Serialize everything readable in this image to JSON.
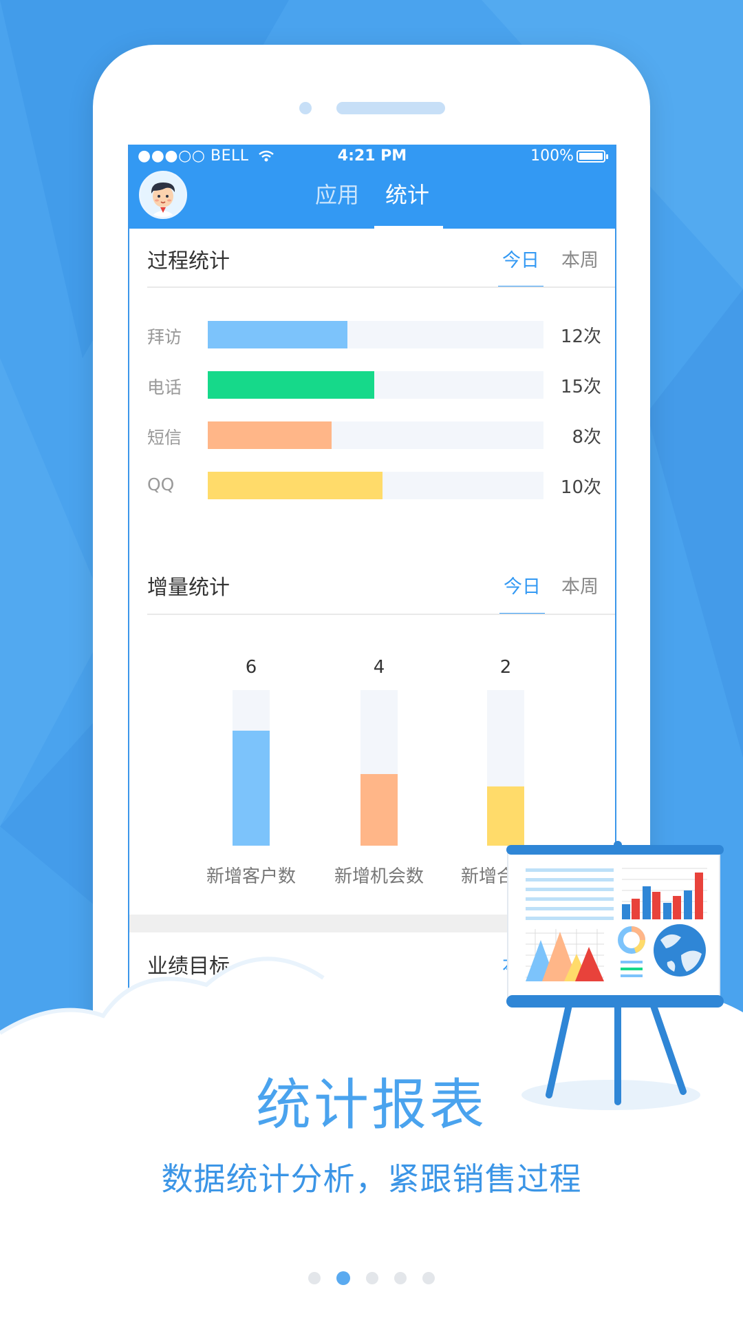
{
  "status_bar": {
    "carrier": "●●●○○ BELL",
    "time": "4:21 PM",
    "battery": "100%"
  },
  "header": {
    "tabs": [
      {
        "label": "应用"
      },
      {
        "label": "统计"
      }
    ],
    "active_tab": "统计"
  },
  "process_stats": {
    "title": "过程统计",
    "segments": {
      "today": "今日",
      "week": "本周"
    },
    "rows": [
      {
        "label": "拜访",
        "value": "12次",
        "fraction": 0.415,
        "color": "#7cc3fb"
      },
      {
        "label": "电话",
        "value": "15次",
        "fraction": 0.495,
        "color": "#16d98a"
      },
      {
        "label": "短信",
        "value": "8次",
        "fraction": 0.368,
        "color": "#ffb688"
      },
      {
        "label": "QQ",
        "value": "10次",
        "fraction": 0.52,
        "color": "#ffdb6a"
      }
    ]
  },
  "increment_stats": {
    "title": "增量统计",
    "segments": {
      "today": "今日",
      "week": "本周"
    },
    "columns": [
      {
        "label": "新增客户数",
        "value": "6",
        "fraction": 0.74,
        "color": "#7cc3fb"
      },
      {
        "label": "新增机会数",
        "value": "4",
        "fraction": 0.46,
        "color": "#ffb688"
      },
      {
        "label": "新增合同数",
        "value": "2",
        "fraction": 0.38,
        "color": "#ffdb6a"
      }
    ]
  },
  "performance": {
    "title": "业绩目标",
    "segment_partial": "本"
  },
  "promo": {
    "title": "统计报表",
    "subtitle": "数据统计分析，紧跟销售过程"
  },
  "pagination": {
    "total": 5,
    "active": 2
  },
  "colors": {
    "primary": "#3399f3",
    "background": "#4aa3ee"
  }
}
